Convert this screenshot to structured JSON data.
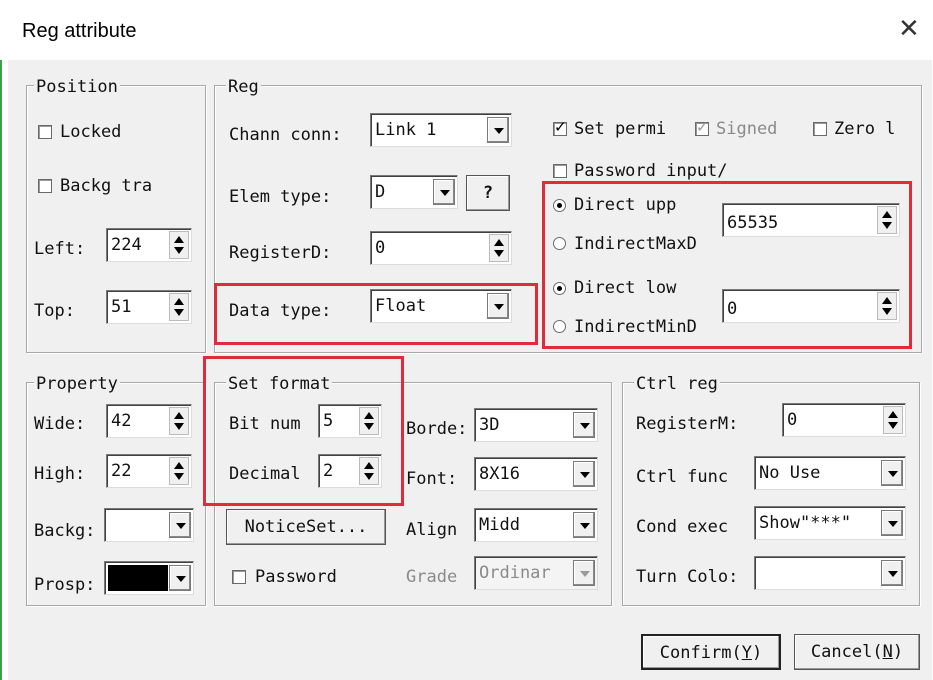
{
  "window": {
    "title": "Reg attribute"
  },
  "position": {
    "group_title": "Position",
    "locked_label": "Locked",
    "backg_label": "Backg tra",
    "left_label": "Left:",
    "left_value": "224",
    "top_label": "Top:",
    "top_value": "51"
  },
  "reg": {
    "group_title": "Reg",
    "chann_label": "Chann conn:",
    "chann_value": "Link 1",
    "elem_label": "Elem type:",
    "elem_value": "D",
    "help_label": "?",
    "registerd_label": "RegisterD:",
    "registerd_value": "0",
    "datatype_label": "Data type:",
    "datatype_value": "Float",
    "set_permi_label": "Set permi",
    "set_permi_checked": true,
    "signed_label": "Signed",
    "zero_label": "Zero l",
    "password_input_label": "Password input/",
    "direct_upper_label": "Direct upp",
    "indirect_max_label": "IndirectMaxD",
    "upper_value": "65535",
    "direct_lower_label": "Direct low",
    "indirect_min_label": "IndirectMinD",
    "lower_value": "0"
  },
  "property": {
    "group_title": "Property",
    "wide_label": "Wide:",
    "wide_value": "42",
    "high_label": "High:",
    "high_value": "22",
    "backg_label": "Backg:",
    "backg_color": "#ffffff",
    "prosp_label": "Prosp:",
    "prosp_color": "#000000"
  },
  "set_format": {
    "group_title": "Set format",
    "bitnum_label": "Bit num",
    "bitnum_value": "5",
    "decimal_label": "Decimal",
    "decimal_value": "2",
    "border_label": "Borde:",
    "border_value": "3D",
    "font_label": "Font:",
    "font_value": "8X16",
    "notice_label": "NoticeSet...",
    "align_label": "Align",
    "align_value": "Midd",
    "password_label": "Password",
    "grade_label": "Grade",
    "grade_value": "Ordinar"
  },
  "ctrl_reg": {
    "group_title": "Ctrl reg",
    "registerm_label": "RegisterM:",
    "registerm_value": "0",
    "ctrl_func_label": "Ctrl func",
    "ctrl_func_value": "No Use",
    "cond_exec_label": "Cond exec",
    "cond_exec_value": "Show\"***\"",
    "turn_colo_label": "Turn Colo:"
  },
  "buttons": {
    "confirm_label": "Confirm(",
    "confirm_key": "Y",
    "cancel_label": "Cancel(",
    "cancel_key": "N",
    "close_symbol": "✕"
  },
  "colors": {
    "highlight_box": "#e02b3a"
  }
}
